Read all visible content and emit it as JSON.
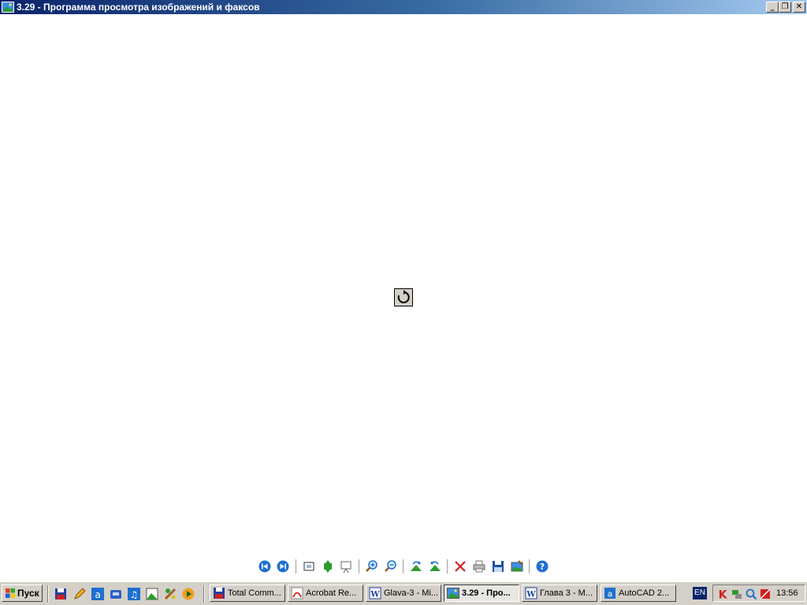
{
  "window": {
    "title": "3.29 - Программа просмотра изображений и факсов",
    "controls": {
      "minimize": "_",
      "maximize": "❐",
      "close": "✕"
    }
  },
  "viewer": {
    "status_icon": "rotate-refresh-icon"
  },
  "toolbar": {
    "buttons": [
      {
        "name": "previous-image-button",
        "icon": "previous-icon"
      },
      {
        "name": "next-image-button",
        "icon": "next-icon"
      },
      {
        "name": "best-fit-button",
        "icon": "best-fit-icon"
      },
      {
        "name": "actual-size-button",
        "icon": "actual-size-icon"
      },
      {
        "name": "slideshow-button",
        "icon": "slideshow-icon"
      },
      {
        "name": "zoom-in-button",
        "icon": "zoom-in-icon"
      },
      {
        "name": "zoom-out-button",
        "icon": "zoom-out-icon"
      },
      {
        "name": "rotate-clockwise-button",
        "icon": "rotate-cw-icon"
      },
      {
        "name": "rotate-counterclockwise-button",
        "icon": "rotate-ccw-icon"
      },
      {
        "name": "delete-button",
        "icon": "delete-icon"
      },
      {
        "name": "print-button",
        "icon": "print-icon"
      },
      {
        "name": "save-button",
        "icon": "save-icon"
      },
      {
        "name": "open-for-editing-button",
        "icon": "edit-image-icon"
      },
      {
        "name": "help-button",
        "icon": "help-icon"
      }
    ]
  },
  "taskbar": {
    "start_label": "Пуск",
    "quick_launch": [
      "floppy-icon",
      "pencil-icon",
      "app-a-icon",
      "phone-icon",
      "music-icon",
      "folder-tree-icon",
      "tools-icon",
      "media-player-icon"
    ],
    "tasks": [
      {
        "label": "Total Comm...",
        "icon": "floppy-icon",
        "active": false
      },
      {
        "label": "Acrobat Re...",
        "icon": "acrobat-icon",
        "active": false
      },
      {
        "label": "Glava-3 - Mi...",
        "icon": "word-icon",
        "active": false
      },
      {
        "label": "3.29 - Про...",
        "icon": "image-viewer-icon",
        "active": true
      },
      {
        "label": "Глава 3 - M...",
        "icon": "word-icon",
        "active": false
      },
      {
        "label": "AutoCAD 2...",
        "icon": "autocad-icon",
        "active": false
      }
    ],
    "language": "EN",
    "tray_icons": [
      "kaspersky-icon",
      "network-icon",
      "search-icon",
      "disabled-icon"
    ],
    "clock": "13:56"
  },
  "colors": {
    "titlebar_start": "#0a246a",
    "titlebar_end": "#a6caf0",
    "taskbar": "#d4d0c8"
  }
}
